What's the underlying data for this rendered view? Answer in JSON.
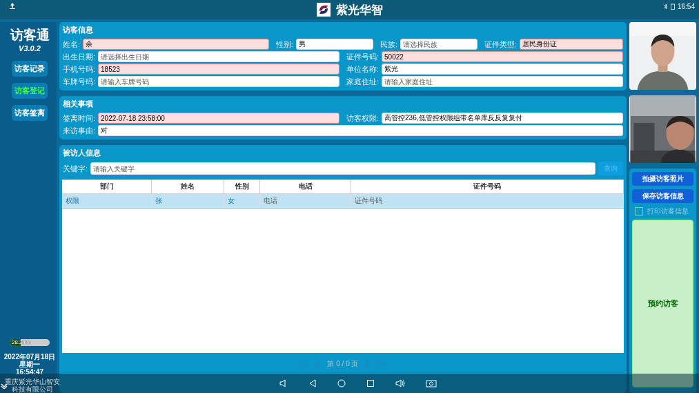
{
  "status_bar": {
    "title": "紫光华智",
    "time": "16:54"
  },
  "sidebar": {
    "app_name": "访客通",
    "version": "V3.0.2",
    "items": [
      {
        "label": "访客记录",
        "selected": false
      },
      {
        "label": "访客登记",
        "selected": true
      },
      {
        "label": "访客签离",
        "selected": false
      }
    ],
    "storage": {
      "level": 0.2824,
      "reading": "28.24%"
    },
    "date": "2022年07月18日",
    "weekday": "星期一",
    "time": "16:54:47",
    "company": "重庆紫光华山智安科技有限公司"
  },
  "visitor_info": {
    "title": "访客信息",
    "rows": [
      [
        {
          "label": "姓名:",
          "value": "余",
          "highlighted": true
        },
        {
          "label": "性别:",
          "value": "男",
          "highlighted": false
        },
        {
          "label": "民族:",
          "placeholder": "请选择民族",
          "highlighted": false
        },
        {
          "label": "证件类型:",
          "value": "居民身份证",
          "highlighted": true
        }
      ],
      [
        {
          "label": "出生日期:",
          "placeholder": "请选择出生日期",
          "highlighted": false
        },
        {
          "label": "证件号码:",
          "value": "50022",
          "highlighted": true
        }
      ],
      [
        {
          "label": "手机号码:",
          "value": "18523",
          "highlighted": true
        },
        {
          "label": "单位名称:",
          "value": "紫光",
          "highlighted": false
        }
      ],
      [
        {
          "label": "车牌号码:",
          "placeholder": "请输入车牌号码",
          "highlighted": false
        },
        {
          "label": "家庭住址:",
          "placeholder": "请输入家庭住址",
          "highlighted": false
        }
      ]
    ]
  },
  "related": {
    "title": "相关事项",
    "rows": [
      [
        {
          "label": "签离时间:",
          "value": "2022-07-18 23:58:00",
          "highlighted": true
        },
        {
          "label": "访客权限:",
          "value": "高管控236,低管控权限组带名单库反反复复付",
          "highlighted": false
        }
      ],
      [
        {
          "label": "来访事由:",
          "value": "对",
          "highlighted": false
        }
      ]
    ]
  },
  "host": {
    "title": "被访人信息",
    "search": {
      "label": "关键字:",
      "placeholder": "请输入关键字"
    },
    "search_button": {
      "label": "查询",
      "disabled": true
    },
    "table": {
      "columns": [
        "部门",
        "姓名",
        "性别",
        "电话",
        "证件号码"
      ],
      "rows": [
        {
          "cells": [
            "权限",
            "张",
            "女",
            "电话",
            "证件号码"
          ],
          "selected": true
        }
      ]
    },
    "pagination": "第 0 / 0 页"
  },
  "actions": {
    "buttons": [
      "拍摄访客照片",
      "保存访客信息"
    ],
    "print": {
      "label": "打印访客信息",
      "checked": false
    },
    "appointment": "预约访客"
  }
}
